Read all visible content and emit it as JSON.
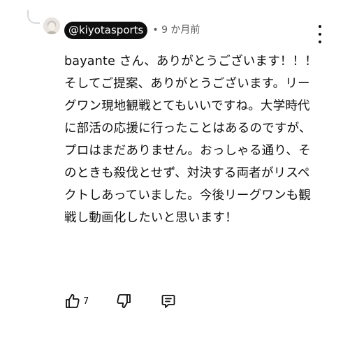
{
  "comment": {
    "author": "@kiyotasports",
    "time": "• 9 か月前",
    "lines": [
      "bayante さん、ありがとうございます！！！",
      "そしてご提案、ありがとうございます。リー",
      "グワン現地観戦とてもいいですね。大学時代",
      "に部活の応援に行ったことはあるのですが、",
      "プロはまだありません。おっしゃる通り、そ",
      "のときも殺伐とせず、対決する両者がリスペ",
      "クトしあっていました。今後リーグワンも観",
      "戦し動画化したいと思います！"
    ]
  },
  "actions": {
    "like_count": "7",
    "icons": [
      "thumbs-up-icon",
      "thumbs-down-icon",
      "reply-icon"
    ]
  },
  "menu": {
    "icon": "more-vertical-icon"
  }
}
